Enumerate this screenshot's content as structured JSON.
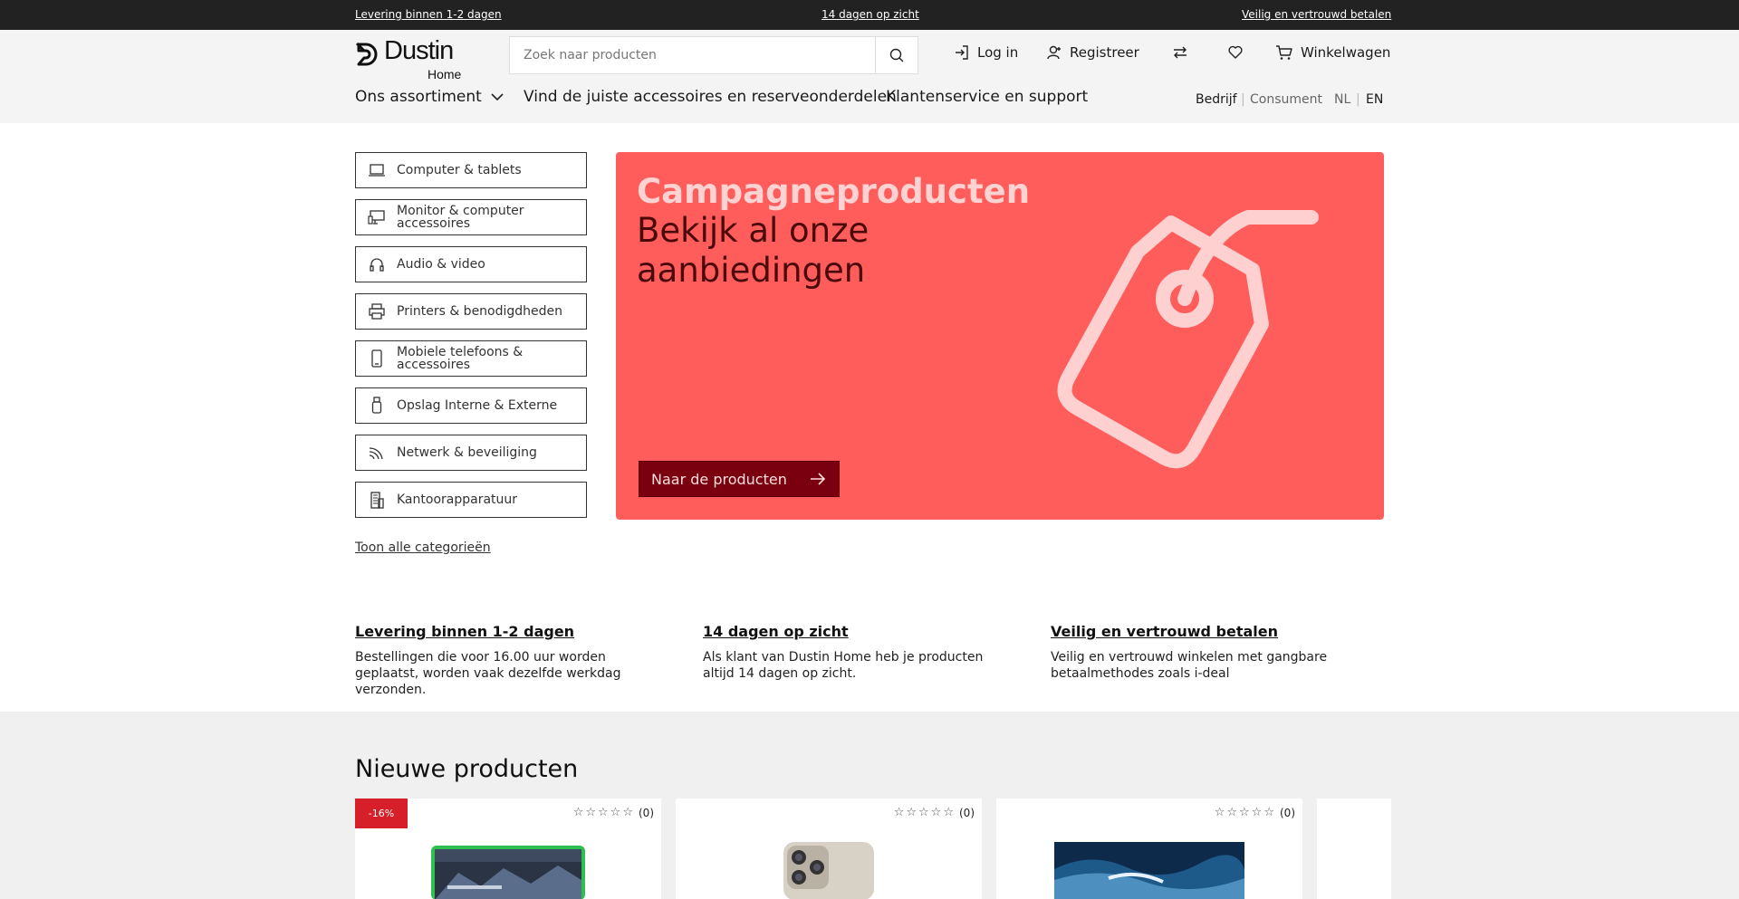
{
  "topbar": {
    "left": "Levering binnen 1-2 dagen",
    "center": "14 dagen op zicht",
    "right": "Veilig en vertrouwd betalen"
  },
  "logo": {
    "word": "Dustin",
    "sub": "Home"
  },
  "search": {
    "placeholder": "Zoek naar producten"
  },
  "header_actions": {
    "login": "Log in",
    "register": "Registreer",
    "cart": "Winkelwagen"
  },
  "nav": {
    "assortment": "Ons assortiment",
    "accessories": "Vind de juiste accessoires en reserveonderdelen",
    "service": "Klantenservice en support"
  },
  "segments": {
    "business": "Bedrijf",
    "sep": "|",
    "consumer": "Consument",
    "nl": "NL",
    "en": "EN"
  },
  "categories": [
    {
      "label": "Computer & tablets",
      "icon": "laptop-icon"
    },
    {
      "label": "Monitor & computer accessoires",
      "icon": "monitor-icon"
    },
    {
      "label": "Audio & video",
      "icon": "headphones-icon"
    },
    {
      "label": "Printers & benodigdheden",
      "icon": "printer-icon"
    },
    {
      "label": "Mobiele telefoons & accessoires",
      "icon": "phone-icon"
    },
    {
      "label": "Opslag Interne & Externe",
      "icon": "usb-drive-icon"
    },
    {
      "label": "Netwerk & beveiliging",
      "icon": "wifi-icon"
    },
    {
      "label": "Kantoorapparatuur",
      "icon": "office-building-icon"
    }
  ],
  "show_all": "Toon alle categorieën",
  "hero": {
    "title": "Campagneproducten",
    "subtitle": "Bekijk al onze aanbiedingen",
    "button": "Naar de producten",
    "bg_color": "#ff5c5c",
    "button_color": "#7a0010"
  },
  "usps": [
    {
      "title": "Levering binnen 1-2 dagen",
      "text": "Bestellingen die voor 16.00 uur worden geplaatst, worden vaak dezelfde werkdag verzonden."
    },
    {
      "title": "14 dagen op zicht",
      "text": "Als klant van Dustin Home heb je producten altijd 14 dagen op zicht."
    },
    {
      "title": "Veilig en vertrouwd betalen",
      "text": "Veilig en vertrouwd winkelen met gangbare betaalmethodes zoals i-deal"
    }
  ],
  "products": {
    "title": "Nieuwe producten",
    "items": [
      {
        "badge": "-16%",
        "stars": "☆☆☆☆☆",
        "reviews": "(0)",
        "image": "tablet-image"
      },
      {
        "badge": "",
        "stars": "☆☆☆☆☆",
        "reviews": "(0)",
        "image": "smartphone-image"
      },
      {
        "badge": "",
        "stars": "☆☆☆☆☆",
        "reviews": "(0)",
        "image": "tv-image"
      }
    ]
  }
}
